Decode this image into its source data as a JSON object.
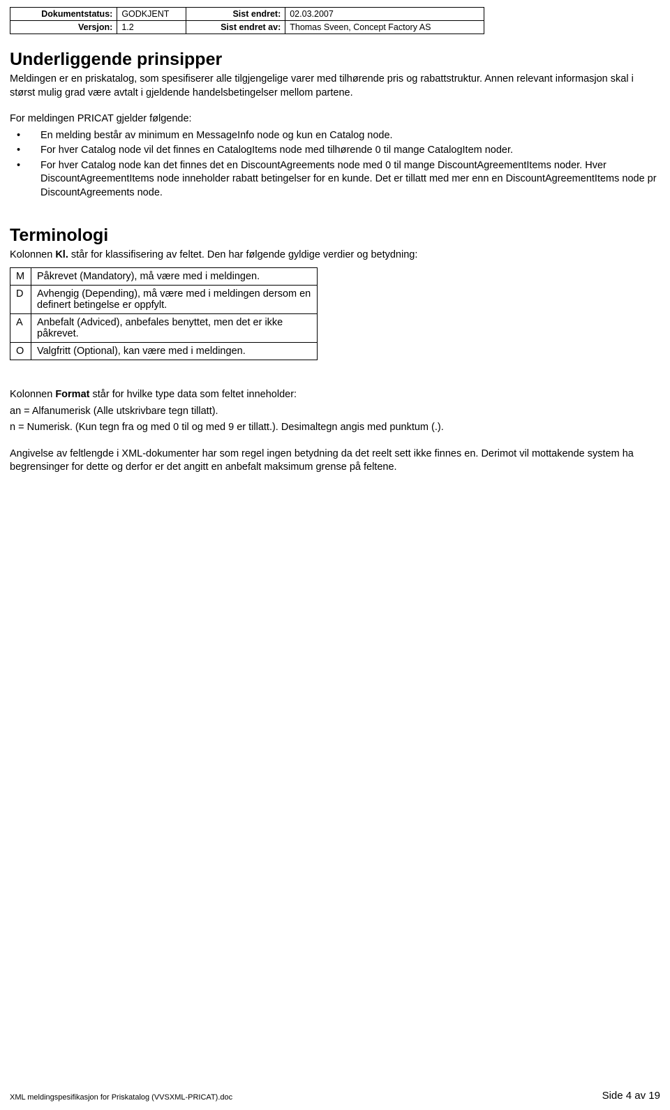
{
  "header": {
    "status_label": "Dokumentstatus:",
    "status_value": "GODKJENT",
    "modified_label": "Sist endret:",
    "modified_value": "02.03.2007",
    "version_label": "Versjon:",
    "version_value": "1.2",
    "modifiedby_label": "Sist endret av:",
    "modifiedby_value": "Thomas Sveen, Concept Factory AS"
  },
  "section1": {
    "title": "Underliggende prinsipper",
    "para1": "Meldingen er en priskatalog, som spesifiserer alle tilgjengelige varer med tilhørende pris og rabattstruktur. Annen relevant informasjon skal i størst mulig grad være avtalt i gjeldende handelsbetingelser mellom partene.",
    "list_intro": "For meldingen PRICAT gjelder følgende:",
    "bullets": [
      "En melding består av minimum en MessageInfo node og kun en Catalog node.",
      "For hver Catalog node vil det finnes en CatalogItems node med tilhørende 0 til mange CatalogItem noder.",
      "For hver Catalog node kan det finnes det en DiscountAgreements node med 0 til mange DiscountAgreementItems noder. Hver DiscountAgreementItems node inneholder rabatt betingelser for en kunde. Det er tillatt med mer enn en DiscountAgreementItems node pr DiscountAgreements node."
    ]
  },
  "section2": {
    "title": "Terminologi",
    "intro_pre": "Kolonnen ",
    "intro_bold": "Kl.",
    "intro_post": " står for klassifisering av feltet. Den har følgende gyldige verdier og betydning:",
    "rows": [
      {
        "code": "M",
        "desc": "Påkrevet (Mandatory), må være med i meldingen."
      },
      {
        "code": "D",
        "desc": "Avhengig (Depending), må være med i meldingen dersom en definert betingelse er oppfylt."
      },
      {
        "code": "A",
        "desc": "Anbefalt (Adviced), anbefales benyttet, men det er ikke påkrevet."
      },
      {
        "code": "O",
        "desc": "Valgfritt (Optional), kan være med i meldingen."
      }
    ],
    "format_pre": "Kolonnen ",
    "format_bold": "Format",
    "format_post": " står for hvilke type data som feltet inneholder:",
    "format_line1": "an = Alfanumerisk (Alle utskrivbare tegn tillatt).",
    "format_line2": "n = Numerisk. (Kun tegn fra og med 0 til og med 9 er tillatt.). Desimaltegn angis med punktum (.).",
    "length_para": "Angivelse av feltlengde i XML-dokumenter har som regel ingen betydning da det reelt sett ikke finnes en. Derimot vil mottakende system ha begrensinger for dette og derfor er det angitt en anbefalt maksimum grense på feltene."
  },
  "footer": {
    "left": "XML meldingspesifikasjon for Priskatalog (VVSXML-PRICAT).doc",
    "right": "Side 4 av 19"
  }
}
